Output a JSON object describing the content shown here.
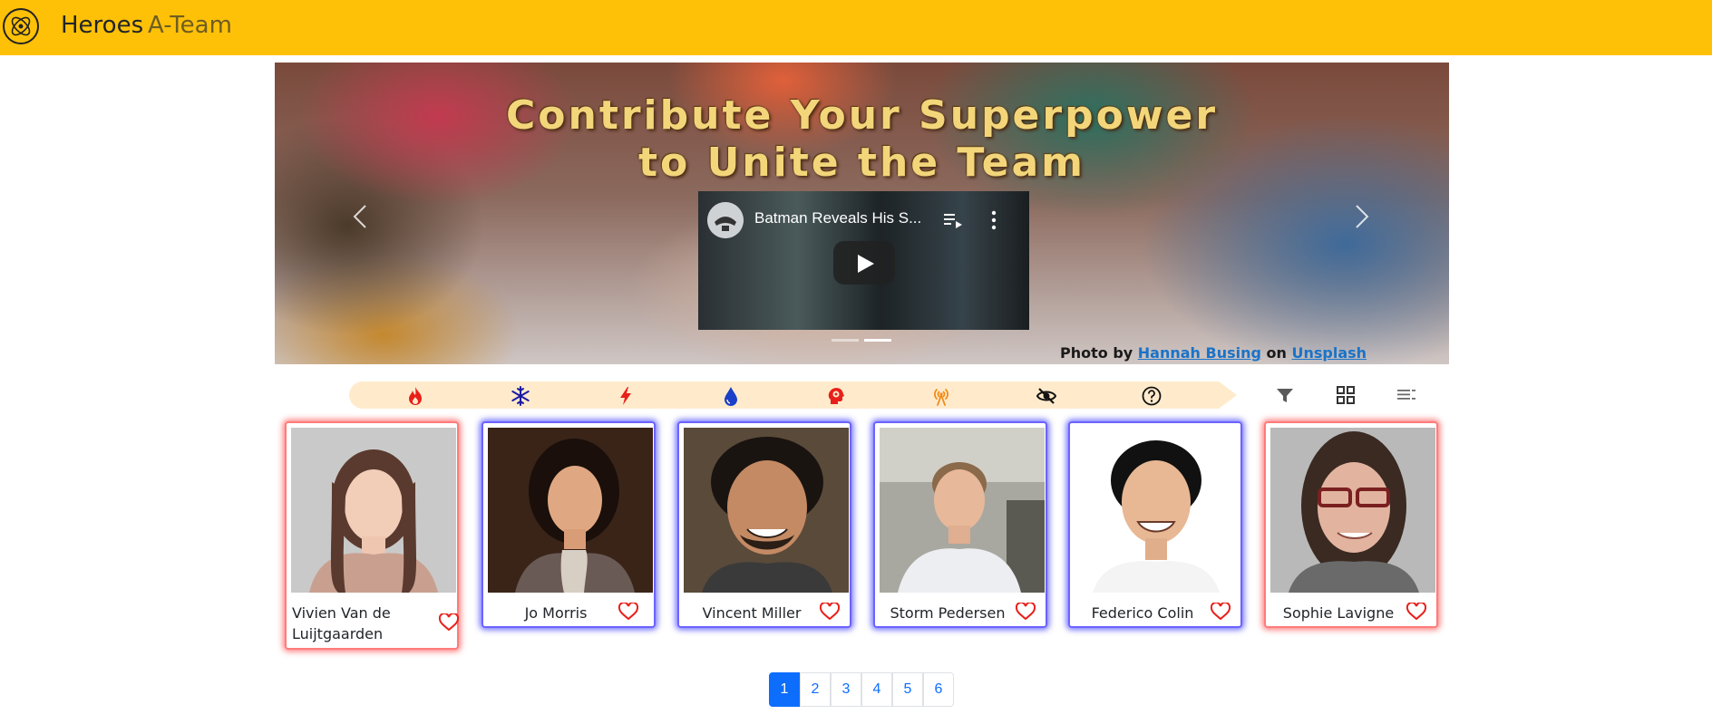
{
  "navbar": {
    "logo_icon": "atom-orbit-logo-icon",
    "brand": "Heroes",
    "link": "A-Team",
    "bg_color": "#ffc107"
  },
  "carousel": {
    "title_line1": "Contribute Your Superpower",
    "title_line2": "to Unite the Team",
    "credit_prefix": "Photo by",
    "credit_author": "Hannah Busing",
    "credit_on": "on",
    "credit_site": "Unsplash",
    "prev_icon": "chevron-left-icon",
    "next_icon": "chevron-right-icon",
    "indicator_count": 2,
    "active_indicator": 2
  },
  "video": {
    "title": "Batman Reveals His S...",
    "queue_icon": "playlist-add-icon",
    "more_icon": "more-vert-icon",
    "play_icon": "play-icon"
  },
  "filters": {
    "powers": [
      {
        "name": "fire",
        "icon": "flame-icon",
        "color": "#e8201a"
      },
      {
        "name": "ice",
        "icon": "snowflake-icon",
        "color": "#1a1aa8"
      },
      {
        "name": "lightning",
        "icon": "lightning-icon",
        "color": "#e8201a"
      },
      {
        "name": "water",
        "icon": "water-drop-icon",
        "color": "#1a3fc8"
      },
      {
        "name": "mind",
        "icon": "brain-head-icon",
        "color": "#e8201a"
      },
      {
        "name": "signal",
        "icon": "antenna-signal-icon",
        "color": "#f08c1a"
      },
      {
        "name": "invisibility",
        "icon": "eye-slash-icon",
        "color": "#111111"
      },
      {
        "name": "unknown",
        "icon": "question-circle-icon",
        "color": "#111111"
      }
    ],
    "tools": [
      {
        "name": "filter",
        "icon": "filter-funnel-icon"
      },
      {
        "name": "grid",
        "icon": "grid-view-icon"
      },
      {
        "name": "list",
        "icon": "list-view-icon"
      }
    ]
  },
  "cards": [
    {
      "name": "Vivien Van de Luijtgaarden",
      "border": "red"
    },
    {
      "name": "Jo Morris",
      "border": "blue"
    },
    {
      "name": "Vincent Miller",
      "border": "blue"
    },
    {
      "name": "Storm Pedersen",
      "border": "blue"
    },
    {
      "name": "Federico Colin",
      "border": "blue"
    },
    {
      "name": "Sophie Lavigne",
      "border": "red"
    }
  ],
  "pagination": {
    "pages": [
      "1",
      "2",
      "3",
      "4",
      "5",
      "6"
    ],
    "active": "1"
  }
}
